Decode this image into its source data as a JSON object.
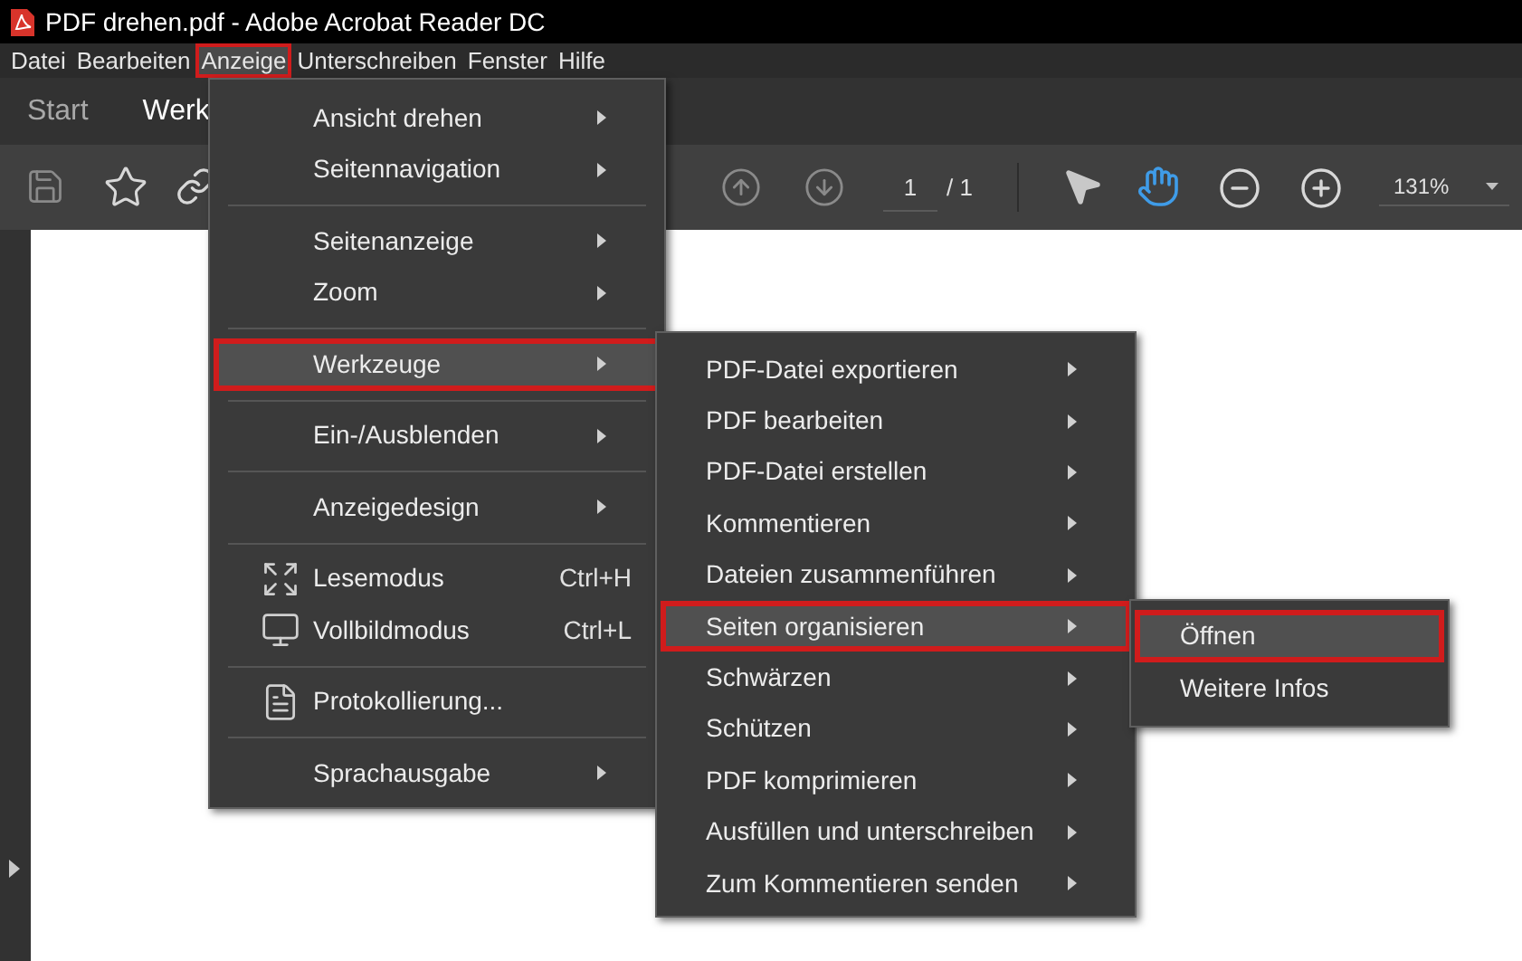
{
  "window": {
    "title": "PDF drehen.pdf - Adobe Acrobat Reader DC"
  },
  "menubar": [
    {
      "label": "Datei",
      "selected": false
    },
    {
      "label": "Bearbeiten",
      "selected": false
    },
    {
      "label": "Anzeige",
      "selected": true
    },
    {
      "label": "Unterschreiben",
      "selected": false
    },
    {
      "label": "Fenster",
      "selected": false
    },
    {
      "label": "Hilfe",
      "selected": false
    }
  ],
  "tabs": [
    {
      "label": "Start",
      "selected": false
    },
    {
      "label": "Werk",
      "selected": true
    }
  ],
  "toolbar": {
    "page": "1",
    "page_total": "/ 1",
    "zoom": "131%",
    "tools": [
      {
        "selected": false
      },
      {
        "selected": true
      }
    ]
  },
  "menu": {
    "groups": [
      [
        {
          "label": "Ansicht drehen",
          "kind": "submenu",
          "selected": false
        },
        {
          "label": "Seitennavigation",
          "kind": "submenu",
          "selected": false
        }
      ],
      [
        {
          "label": "Seitenanzeige",
          "kind": "submenu",
          "selected": false
        },
        {
          "label": "Zoom",
          "kind": "submenu",
          "selected": false
        }
      ],
      [
        {
          "label": "Werkzeuge",
          "kind": "submenu",
          "selected": true
        }
      ],
      [
        {
          "label": "Ein-/Ausblenden",
          "kind": "submenu",
          "selected": false
        }
      ],
      [
        {
          "label": "Anzeigedesign",
          "kind": "submenu",
          "selected": false
        }
      ],
      [
        {
          "label": "Lesemodus",
          "kind": "command",
          "shortcut": "Ctrl+H",
          "selected": false
        },
        {
          "label": "Vollbildmodus",
          "kind": "command",
          "shortcut": "Ctrl+L",
          "selected": false
        }
      ],
      [
        {
          "label": "Protokollierung...",
          "kind": "command",
          "selected": false
        }
      ],
      [
        {
          "label": "Sprachausgabe",
          "kind": "submenu",
          "selected": false
        }
      ]
    ]
  },
  "submenu": {
    "items": [
      {
        "label": "PDF-Datei exportieren",
        "kind": "submenu",
        "selected": false
      },
      {
        "label": "PDF bearbeiten",
        "kind": "submenu",
        "selected": false
      },
      {
        "label": "PDF-Datei erstellen",
        "kind": "submenu",
        "selected": false
      },
      {
        "label": "Kommentieren",
        "kind": "submenu",
        "selected": false
      },
      {
        "label": "Dateien zusammenführen",
        "kind": "submenu",
        "selected": false
      },
      {
        "label": "Seiten organisieren",
        "kind": "submenu",
        "selected": true
      },
      {
        "label": "Schwärzen",
        "kind": "submenu",
        "selected": false
      },
      {
        "label": "Schützen",
        "kind": "submenu",
        "selected": false
      },
      {
        "label": "PDF komprimieren",
        "kind": "submenu",
        "selected": false
      },
      {
        "label": "Ausfüllen und unterschreiben",
        "kind": "submenu",
        "selected": false
      },
      {
        "label": "Zum Kommentieren senden",
        "kind": "submenu",
        "selected": false
      }
    ]
  },
  "subsubmenu": {
    "items": [
      {
        "label": "Öffnen",
        "selected": true
      },
      {
        "label": "Weitere Infos",
        "selected": false
      }
    ]
  }
}
